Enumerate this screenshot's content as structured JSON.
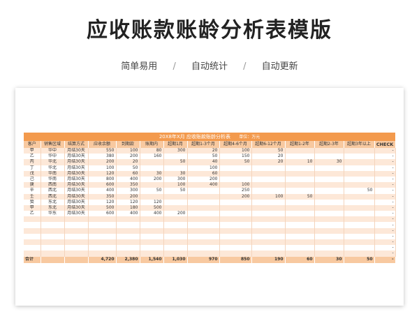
{
  "header": {
    "title": "应收账款账龄分析表模版",
    "features": [
      "简单易用",
      "自动统计",
      "自动更新"
    ],
    "separator": "/"
  },
  "sheet": {
    "title": "20X8年X月  应收账款账龄分析表",
    "unit": "单位：万元",
    "columns": [
      "客户",
      "销售区域",
      "结算方式",
      "应收余额",
      "到期款",
      "账期内",
      "超期1月",
      "超期1-3个月",
      "超期4-6个月",
      "超期6-12个月",
      "超期1-2年",
      "超期2-3年",
      "超期3年以上",
      "CHECK"
    ],
    "rows": [
      [
        "甲",
        "华中",
        "月结30天",
        "550",
        "100",
        "80",
        "300",
        "20",
        "100",
        "50",
        "",
        "",
        "",
        "-"
      ],
      [
        "乙",
        "华中",
        "月结30天",
        "380",
        "200",
        "160",
        "",
        "50",
        "150",
        "20",
        "",
        "",
        "",
        "-"
      ],
      [
        "丙",
        "华北",
        "月结30天",
        "200",
        "20",
        "",
        "50",
        "40",
        "50",
        "20",
        "10",
        "30",
        "",
        "-"
      ],
      [
        "丁",
        "华北",
        "月结30天",
        "100",
        "50",
        "",
        "",
        "100",
        "",
        "",
        "",
        "",
        "",
        "-"
      ],
      [
        "戊",
        "华南",
        "月结30天",
        "120",
        "60",
        "30",
        "30",
        "60",
        "",
        "",
        "",
        "",
        "",
        "-"
      ],
      [
        "己",
        "华南",
        "月结30天",
        "800",
        "400",
        "200",
        "300",
        "200",
        "",
        "",
        "",
        "",
        "",
        "-"
      ],
      [
        "庚",
        "西南",
        "月结30天",
        "600",
        "350",
        "",
        "100",
        "400",
        "100",
        "",
        "",
        "",
        "",
        "-"
      ],
      [
        "辛",
        "西北",
        "月结30天",
        "400",
        "300",
        "50",
        "50",
        "",
        "250",
        "",
        "",
        "",
        "50",
        "-"
      ],
      [
        "壬",
        "西北",
        "月结30天",
        "350",
        "200",
        "",
        "",
        "",
        "200",
        "100",
        "50",
        "",
        "",
        "-"
      ],
      [
        "癸",
        "东北",
        "月结30天",
        "120",
        "120",
        "120",
        "",
        "",
        "",
        "",
        "",
        "",
        "",
        "-"
      ],
      [
        "甲",
        "东北",
        "月结30天",
        "500",
        "180",
        "500",
        "",
        "",
        "",
        "",
        "",
        "",
        "",
        "-"
      ],
      [
        "乙",
        "华东",
        "月结30天",
        "600",
        "400",
        "400",
        "200",
        "",
        "",
        "",
        "",
        "",
        "",
        "-"
      ],
      [
        "",
        "",
        "",
        "",
        "",
        "",
        "",
        "",
        "",
        "",
        "",
        "",
        "",
        "-"
      ],
      [
        "",
        "",
        "",
        "",
        "",
        "",
        "",
        "",
        "",
        "",
        "",
        "",
        "",
        "-"
      ],
      [
        "",
        "",
        "",
        "",
        "",
        "",
        "",
        "",
        "",
        "",
        "",
        "",
        "",
        "-"
      ],
      [
        "",
        "",
        "",
        "",
        "",
        "",
        "",
        "",
        "",
        "",
        "",
        "",
        "",
        "-"
      ],
      [
        "",
        "",
        "",
        "",
        "",
        "",
        "",
        "",
        "",
        "",
        "",
        "",
        "",
        "-"
      ],
      [
        "",
        "",
        "",
        "",
        "",
        "",
        "",
        "",
        "",
        "",
        "",
        "",
        "",
        "-"
      ],
      [
        "",
        "",
        "",
        "",
        "",
        "",
        "",
        "",
        "",
        "",
        "",
        "",
        "",
        "-"
      ]
    ],
    "totals": [
      "合计",
      "",
      "",
      "4,720",
      "2,380",
      "1,540",
      "1,030",
      "970",
      "850",
      "190",
      "60",
      "30",
      "50",
      "-"
    ]
  },
  "colors": {
    "title_bar": "#f39a4d",
    "header_fill": "#f8c9a0",
    "row_stripe": "#fde8d8"
  }
}
